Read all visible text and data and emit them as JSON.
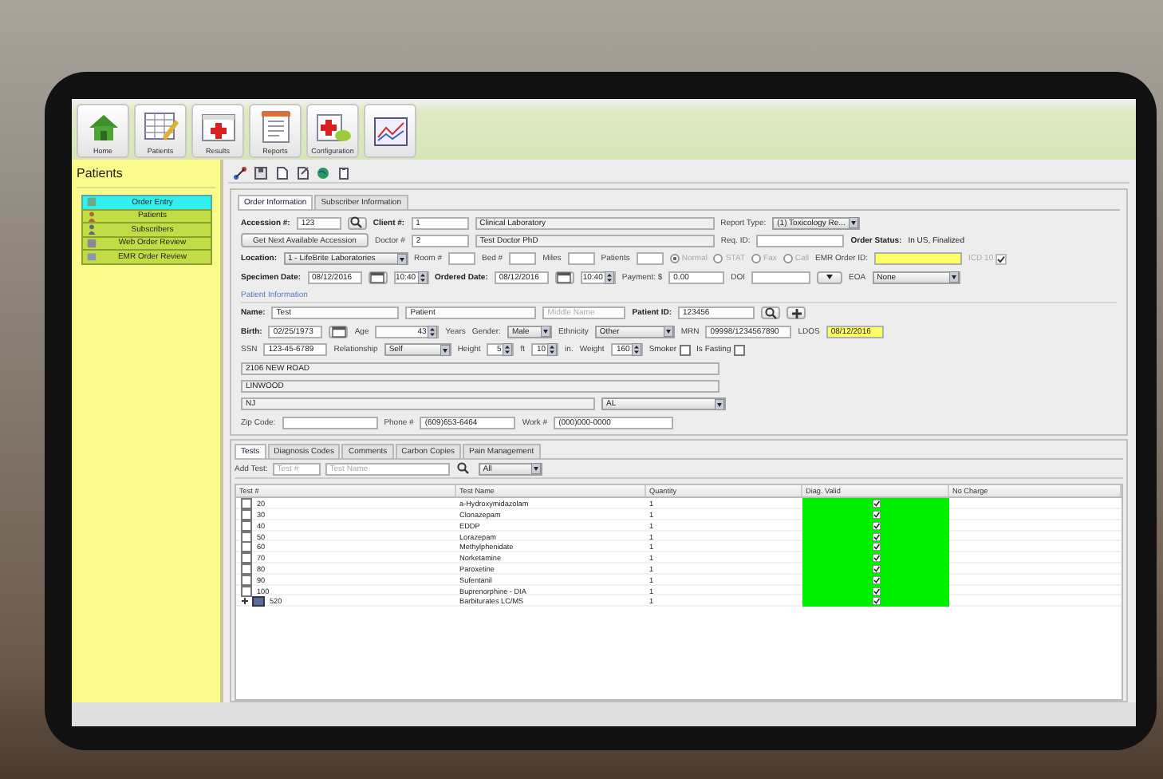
{
  "toolbar": {
    "buttons": [
      {
        "kind": "home",
        "label": "Home"
      },
      {
        "kind": "patients",
        "label": "Patients"
      },
      {
        "kind": "results",
        "label": "Results"
      },
      {
        "kind": "reports",
        "label": "Reports"
      },
      {
        "kind": "configuration",
        "label": "Configuration"
      },
      {
        "kind": "charts"
      }
    ]
  },
  "sidebar": {
    "title": "Patients",
    "items": [
      {
        "label": "Order Entry",
        "selected": true
      },
      {
        "label": "Patients",
        "selected": false
      },
      {
        "label": "Subscribers",
        "selected": false
      },
      {
        "label": "Web Order Review",
        "selected": false
      },
      {
        "label": "EMR Order Review",
        "selected": false
      }
    ]
  },
  "form_tabs": [
    {
      "label": "Order Information",
      "selected": true
    },
    {
      "label": "Subscriber Information",
      "selected": false
    }
  ],
  "order_rows": [
    [
      {
        "kind": "label",
        "text": "Accession #:",
        "bold": true
      },
      {
        "kind": "field",
        "value": "123"
      },
      {
        "kind": "search"
      },
      {
        "kind": "label",
        "text": "Client #:",
        "bold": true
      },
      {
        "kind": "field",
        "value": "1"
      },
      {
        "kind": "field",
        "value": "Clinical Laboratory",
        "disabled": true
      },
      {
        "kind": "label",
        "text": "Report Type:"
      },
      {
        "kind": "select",
        "value": "(1) Toxicology Re..."
      }
    ],
    [
      {
        "kind": "button",
        "text": "Get Next Available Accession"
      },
      {
        "kind": "label",
        "text": "Doctor #"
      },
      {
        "kind": "field",
        "value": "2"
      },
      {
        "kind": "field",
        "value": "Test Doctor PhD",
        "disabled": true
      },
      {
        "kind": "label",
        "text": "Req. ID:"
      },
      {
        "kind": "field"
      },
      {
        "kind": "label",
        "text": "Order Status:",
        "bold": true
      },
      {
        "kind": "text",
        "text": "In US, Finalized"
      }
    ],
    [
      {
        "kind": "label",
        "text": "Location:",
        "bold": true
      },
      {
        "kind": "select",
        "value": "1 - LifeBrite Laboratories"
      },
      {
        "kind": "label",
        "text": "Room #"
      },
      {
        "kind": "field"
      },
      {
        "kind": "label",
        "text": "Bed #"
      },
      {
        "kind": "field"
      },
      {
        "kind": "label",
        "text": "Miles"
      },
      {
        "kind": "field"
      },
      {
        "kind": "label",
        "text": "Patients"
      },
      {
        "kind": "field"
      },
      {
        "kind": "radio",
        "label": "Normal",
        "selected": true,
        "disabled": true
      },
      {
        "kind": "radio",
        "label": "STAT",
        "selected": false,
        "disabled": true
      },
      {
        "kind": "radio",
        "label": "Fax",
        "selected": false,
        "disabled": true
      },
      {
        "kind": "radio",
        "label": "Call",
        "selected": false,
        "disabled": true
      },
      {
        "kind": "label",
        "text": "EMR Order ID:"
      },
      {
        "kind": "field",
        "highlight": true
      },
      {
        "kind": "checkbox",
        "label": "ICD 10",
        "checked": true,
        "disabled": true
      }
    ],
    [
      {
        "kind": "label",
        "text": "Specimen Date:",
        "bold": true
      },
      {
        "kind": "field",
        "value": "08/12/2016"
      },
      {
        "kind": "calendar"
      },
      {
        "kind": "spinner",
        "value": "10:40"
      },
      {
        "kind": "label",
        "text": "Ordered Date:",
        "bold": true
      },
      {
        "kind": "field",
        "value": "08/12/2016"
      },
      {
        "kind": "calendar"
      },
      {
        "kind": "spinner",
        "value": "10:40"
      },
      {
        "kind": "label",
        "text": "Payment: $"
      },
      {
        "kind": "field",
        "value": "0.00"
      },
      {
        "kind": "label",
        "text": "DOI"
      },
      {
        "kind": "field"
      },
      {
        "kind": "dropdown"
      },
      {
        "kind": "label",
        "text": "EOA"
      },
      {
        "kind": "select",
        "value": "None"
      }
    ]
  ],
  "patient_heading": "Patient Information",
  "patient_rows": [
    [
      {
        "kind": "label",
        "text": "Name:",
        "bold": true
      },
      {
        "kind": "field",
        "value": "Test"
      },
      {
        "kind": "field",
        "value": "Patient"
      },
      {
        "kind": "field",
        "placeholder": "Middle Name"
      },
      {
        "kind": "label",
        "text": "Patient ID:",
        "bold": true
      },
      {
        "kind": "field",
        "value": "123456"
      },
      {
        "kind": "search"
      },
      {
        "kind": "add"
      }
    ],
    [
      {
        "kind": "label",
        "text": "Birth:",
        "bold": true
      },
      {
        "kind": "field",
        "value": "02/25/1973"
      },
      {
        "kind": "calendar"
      },
      {
        "kind": "label",
        "text": "Age"
      },
      {
        "kind": "spinner",
        "value": "43"
      },
      {
        "kind": "label",
        "text": "Years"
      },
      {
        "kind": "label",
        "text": "Gender:"
      },
      {
        "kind": "select",
        "value": "Male"
      },
      {
        "kind": "label",
        "text": "Ethnicity"
      },
      {
        "kind": "select",
        "value": "Other"
      },
      {
        "kind": "label",
        "text": "MRN"
      },
      {
        "kind": "field",
        "value": "09998/1234567890"
      },
      {
        "kind": "label",
        "text": "LDOS"
      },
      {
        "kind": "field",
        "value": "08/12/2016",
        "highlight": true
      }
    ],
    [
      {
        "kind": "label",
        "text": "SSN"
      },
      {
        "kind": "field",
        "value": "123-45-6789"
      },
      {
        "kind": "label",
        "text": "Relationship"
      },
      {
        "kind": "select",
        "value": "Self"
      },
      {
        "kind": "label",
        "text": "Height"
      },
      {
        "kind": "spinner",
        "value": "5"
      },
      {
        "kind": "label",
        "text": "ft"
      },
      {
        "kind": "spinner",
        "value": "10"
      },
      {
        "kind": "label",
        "text": "in."
      },
      {
        "kind": "label",
        "text": "Weight"
      },
      {
        "kind": "spinner",
        "value": "160"
      },
      {
        "kind": "checkbox",
        "label": "Smoker",
        "checked": false
      },
      {
        "kind": "checkbox",
        "label": "Is Fasting",
        "checked": false
      }
    ],
    [
      {
        "kind": "field",
        "value": "2106 NEW ROAD",
        "disabled": true
      }
    ],
    [
      {
        "kind": "field",
        "value": "LINWOOD",
        "disabled": true
      }
    ],
    [
      {
        "kind": "field",
        "value": "NJ",
        "disabled": true
      },
      {
        "kind": "select",
        "value": "AL"
      }
    ],
    [
      {
        "kind": "label",
        "text": "Zip Code:"
      },
      {
        "kind": "field"
      },
      {
        "kind": "label",
        "text": "Phone #"
      },
      {
        "kind": "field",
        "value": "(609)653-6464"
      },
      {
        "kind": "label",
        "text": "Work #"
      },
      {
        "kind": "field",
        "value": "(000)000-0000"
      }
    ]
  ],
  "test_tabs": [
    {
      "label": "Tests",
      "selected": true
    },
    {
      "label": "Diagnosis Codes",
      "selected": false
    },
    {
      "label": "Comments",
      "selected": false
    },
    {
      "label": "Carbon Copies",
      "selected": false
    },
    {
      "label": "Pain Management",
      "selected": false
    }
  ],
  "add_test": {
    "label": "Add Test:",
    "test_no_placeholder": "Test #",
    "test_name_placeholder": "Test Name",
    "filter": "All"
  },
  "table": {
    "columns": [
      "Test #",
      "Test Name",
      "Quantity",
      "Diag. Valid",
      "No Charge"
    ],
    "rows": [
      {
        "kind": "test",
        "checked": false,
        "test_no": "20",
        "test_name": "a-Hydroxymidazolam",
        "quantity": "1",
        "diag_valid": true
      },
      {
        "kind": "test",
        "checked": false,
        "test_no": "30",
        "test_name": "Clonazepam",
        "quantity": "1",
        "diag_valid": true
      },
      {
        "kind": "test",
        "checked": false,
        "test_no": "40",
        "test_name": "EDDP",
        "quantity": "1",
        "diag_valid": true
      },
      {
        "kind": "test",
        "checked": false,
        "test_no": "50",
        "test_name": "Lorazepam",
        "quantity": "1",
        "diag_valid": true
      },
      {
        "kind": "test",
        "checked": false,
        "test_no": "60",
        "test_name": "Methylphenidate",
        "quantity": "1",
        "diag_valid": true
      },
      {
        "kind": "test",
        "checked": false,
        "test_no": "70",
        "test_name": "Norketamine",
        "quantity": "1",
        "diag_valid": true
      },
      {
        "kind": "test",
        "checked": false,
        "test_no": "80",
        "test_name": "Paroxetine",
        "quantity": "1",
        "diag_valid": true
      },
      {
        "kind": "test",
        "checked": false,
        "test_no": "90",
        "test_name": "Sufentanil",
        "quantity": "1",
        "diag_valid": true
      },
      {
        "kind": "test",
        "checked": false,
        "test_no": "100",
        "test_name": "Buprenorphine - DIA",
        "quantity": "1",
        "diag_valid": true
      },
      {
        "kind": "panel",
        "expanded": false,
        "test_no": "520",
        "test_name": "Barbiturates LC/MS",
        "quantity": "1",
        "diag_valid": true
      }
    ]
  }
}
